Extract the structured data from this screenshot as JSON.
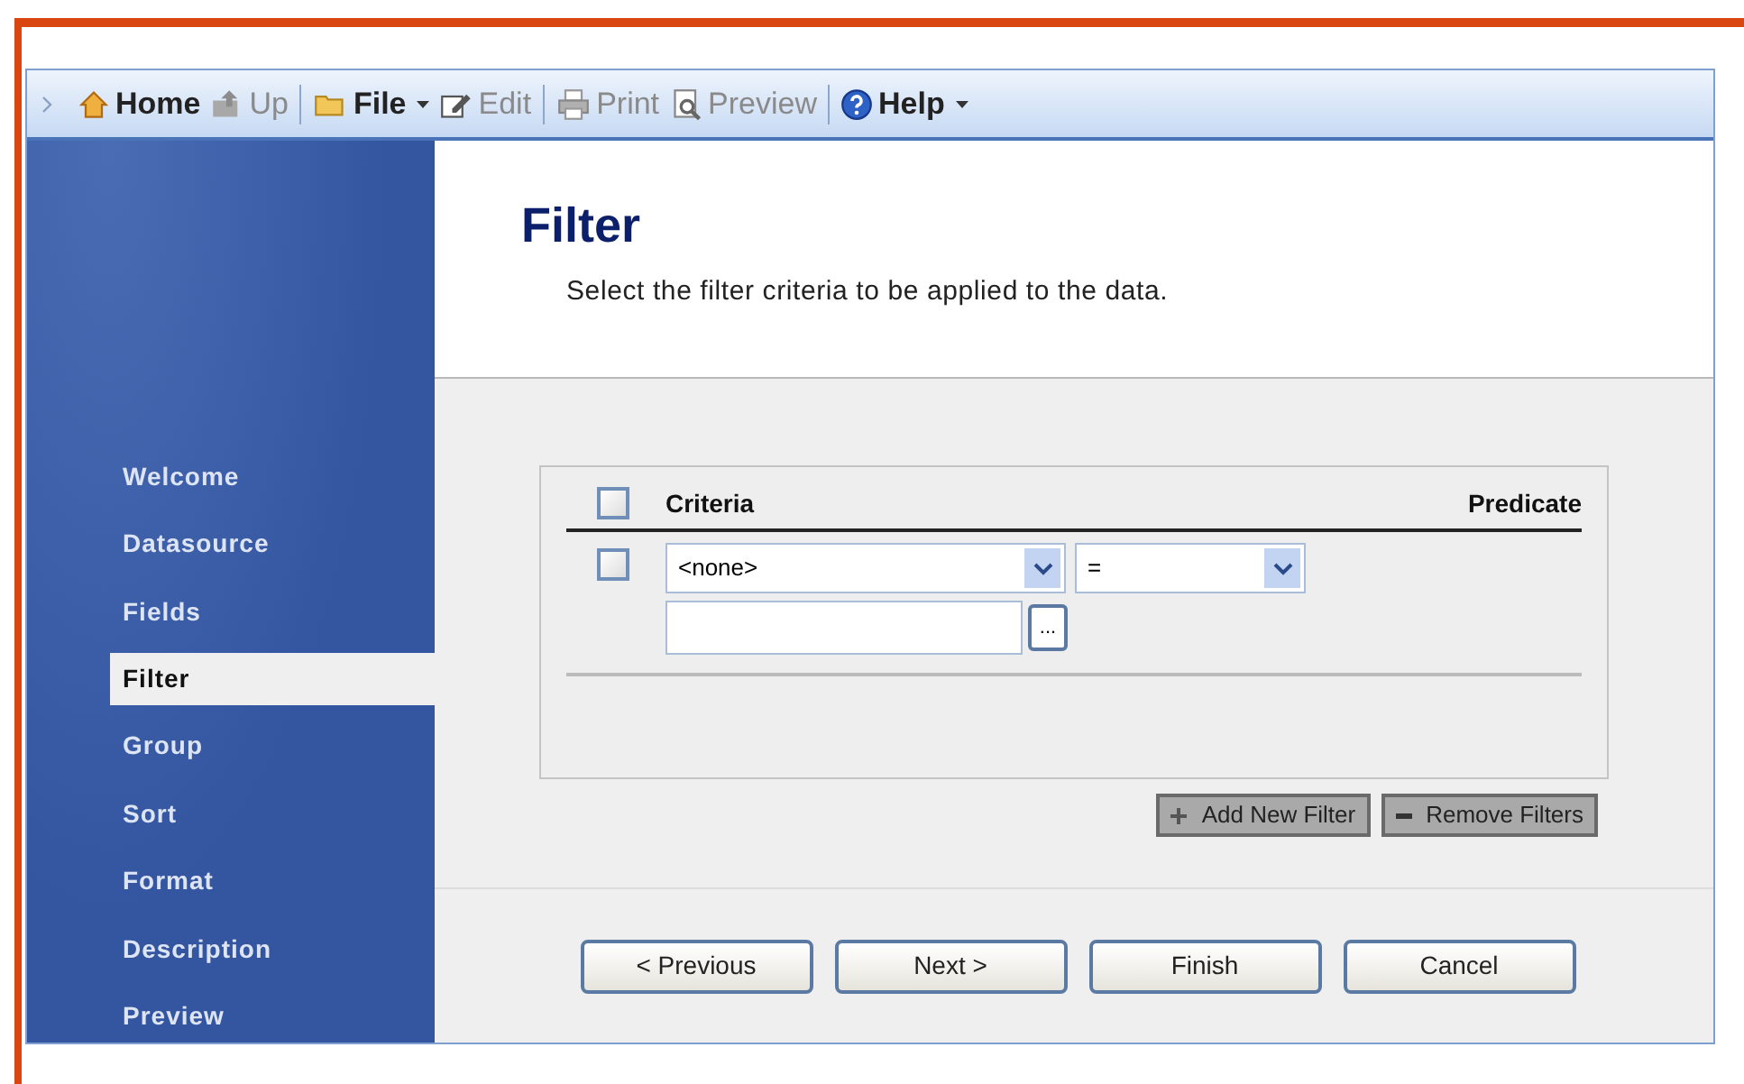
{
  "toolbar": {
    "items": [
      {
        "kind": "item",
        "label": "Home",
        "disabled": false,
        "caret": false
      },
      {
        "kind": "item",
        "label": "Up",
        "disabled": true,
        "caret": false
      },
      {
        "kind": "separator"
      },
      {
        "kind": "item",
        "label": "File",
        "disabled": false,
        "caret": true
      },
      {
        "kind": "item",
        "label": "Edit",
        "disabled": true,
        "caret": false
      },
      {
        "kind": "separator"
      },
      {
        "kind": "item",
        "label": "Print",
        "disabled": true,
        "caret": false
      },
      {
        "kind": "item",
        "label": "Preview",
        "disabled": true,
        "caret": false
      },
      {
        "kind": "separator"
      },
      {
        "kind": "item",
        "label": "Help",
        "disabled": false,
        "caret": true
      }
    ]
  },
  "sidebar": {
    "items": [
      {
        "label": "Welcome",
        "selected": false
      },
      {
        "label": "Datasource",
        "selected": false
      },
      {
        "label": "Fields",
        "selected": false
      },
      {
        "label": "Filter",
        "selected": true
      },
      {
        "label": "Group",
        "selected": false
      },
      {
        "label": "Sort",
        "selected": false
      },
      {
        "label": "Format",
        "selected": false
      },
      {
        "label": "Description",
        "selected": false
      },
      {
        "label": "Preview",
        "selected": false
      }
    ]
  },
  "header": {
    "title": "Filter",
    "subtitle": "Select the filter criteria to be applied to the data."
  },
  "filter_table": {
    "select_all_checked": false,
    "columns": [
      "Criteria",
      "Predicate"
    ],
    "rows": [
      {
        "checked": false,
        "criteria": "<none>",
        "operator": "=",
        "value": "",
        "browse": "..."
      }
    ]
  },
  "filter_buttons": [
    "Add New Filter",
    "Remove Filters"
  ],
  "nav_buttons": [
    "< Previous",
    "Next >",
    "Finish",
    "Cancel"
  ]
}
